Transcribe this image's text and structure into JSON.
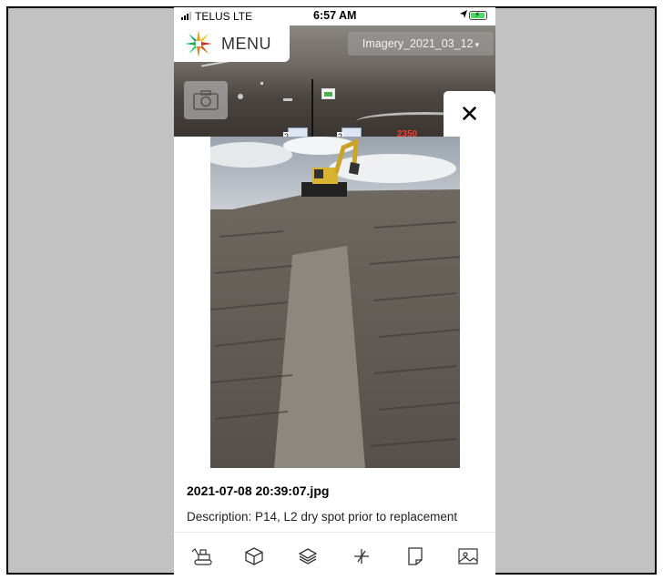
{
  "status_bar": {
    "carrier": "TELUS LTE",
    "time": "6:57 AM",
    "location_icon": "location-arrow-icon",
    "battery_icon": "battery-charging-icon"
  },
  "map": {
    "menu_label": "MENU",
    "imagery_value": "Imagery_2021_03_12",
    "camera_icon": "camera-icon",
    "marker_count_a": "2",
    "marker_count_b": "2",
    "elevation_label": "2350"
  },
  "photo_modal": {
    "close_symbol": "✕",
    "filename": "2021-07-08 20:39:07.jpg",
    "description": "Description: P14, L2 dry spot prior to replacement"
  },
  "toolbar": {
    "items": [
      {
        "icon": "excavator-icon"
      },
      {
        "icon": "cube-3d-icon"
      },
      {
        "icon": "layers-icon"
      },
      {
        "icon": "measure-icon"
      },
      {
        "icon": "note-icon"
      },
      {
        "icon": "image-icon"
      }
    ]
  },
  "colors": {
    "frame_background": "#c2c2c2",
    "elevation_label": "#ff3b30",
    "imagery_select_bg": "#a0a0a0",
    "battery_charge": "#4cd964"
  }
}
